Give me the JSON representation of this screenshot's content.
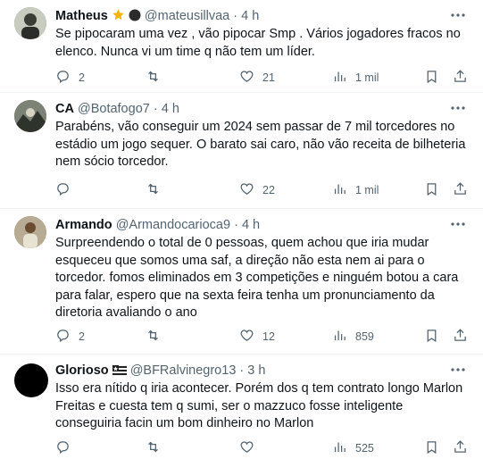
{
  "tweets": [
    {
      "name": "Matheus",
      "badges": [
        "star-emoji",
        "black-circle-emoji"
      ],
      "handle": "@mateusillvaa",
      "time": "4 h",
      "text": "Se pipocaram uma vez , vão pipocar Smp . Vários jogadores fracos no elenco. Nunca vi um time q não tem um líder.",
      "replies": "2",
      "retweets": "",
      "likes": "21",
      "views": "1 mil",
      "avatar_color": "#5a6b5c"
    },
    {
      "name": "CA",
      "badges": [],
      "handle": "@Botafogo7",
      "time": "4 h",
      "text": "Parabéns, vão conseguir um 2024 sem passar de 7 mil torcedores no estádio um jogo sequer. O barato sai caro, não vão receita de bilheteria nem sócio torcedor.",
      "replies": "",
      "retweets": "",
      "likes": "22",
      "views": "1 mil",
      "avatar_color": "#4a4f47"
    },
    {
      "name": "Armando",
      "badges": [],
      "handle": "@Armandocarioca9",
      "time": "4 h",
      "text": "Surpreendendo o total de 0 pessoas, quem achou que iria mudar esqueceu que somos uma saf, a direção não esta nem ai para o torcedor. fomos eliminados em 3 competições e ninguém botou a cara para falar, espero que na sexta feira tenha um pronunciamento da diretoria avaliando o ano",
      "replies": "2",
      "retweets": "",
      "likes": "12",
      "views": "859",
      "avatar_color": "#8a7a66"
    },
    {
      "name": "Glorioso",
      "badges": [
        "flag-emoji"
      ],
      "handle": "@BFRalvinegro13",
      "time": "3 h",
      "text": "Isso era nítido q iria acontecer. Porém dos q tem contrato longo Marlon Freitas e cuesta tem q sumi, ser o mazzuco fosse inteligente conseguiria facin um bom dinheiro no Marlon",
      "replies": "",
      "retweets": "",
      "likes": "",
      "views": "525",
      "avatar_color": "#000000"
    }
  ],
  "colors": {
    "text": "#0f1419",
    "secondary": "#536471",
    "divider": "#eff3f4",
    "star": "#f5b400"
  },
  "dot": "·"
}
